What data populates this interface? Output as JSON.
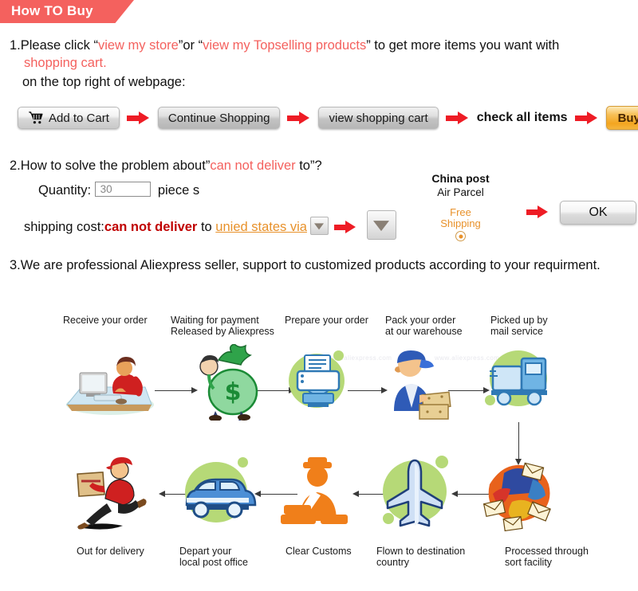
{
  "banner": {
    "title": "How TO Buy",
    "color": "#f4615e"
  },
  "colors": {
    "accent_red": "#f4615e",
    "arrow_red": "#ee1c25",
    "dark_red": "#c00000",
    "orange": "#e8912a",
    "buy_now_bg": "#f3a520",
    "blob_green": "#b6d977"
  },
  "section1": {
    "number": "1.",
    "line1_a": "Please click “",
    "link1": "view my store",
    "line1_b": "”or “",
    "link2": "view my Topselling products",
    "line1_c": "” to get more items you want with",
    "line2": "shopping cart.",
    "line3": "on the top right of webpage:",
    "buttons": {
      "add_to_cart": "Add to Cart",
      "continue_shopping": "Continue Shopping",
      "view_shopping_cart": "view shopping cart",
      "check_all_items": "check all items",
      "buy_now": "Buy now"
    }
  },
  "section2": {
    "number": "2.",
    "line1_a": "How to solve the problem about”",
    "line1_red": "can not deliver",
    "line1_b": " to”?",
    "quantity_label": "Quantity:",
    "quantity_value": "30",
    "quantity_unit": "piece s",
    "shipping_label": "shipping cost:",
    "shipping_red": "can not deliver",
    "shipping_to": " to ",
    "shipping_link": "unied states via",
    "carrier": "China post",
    "service": "Air Parcel",
    "free_line1": "Free",
    "free_line2": "Shipping",
    "ok_button": "OK"
  },
  "section3": {
    "number": "3.",
    "text": "We are professional Aliexpress seller, support to customized products according to your requirment."
  },
  "flow": {
    "steps_top": [
      {
        "label": "Receive your order",
        "icon": "person-at-computer-icon"
      },
      {
        "label": "Waiting for payment\nReleased by Aliexpress",
        "icon": "money-bag-icon"
      },
      {
        "label": "Prepare your order",
        "icon": "printer-icon"
      },
      {
        "label": "Pack your order\nat our warehouse",
        "icon": "warehouse-worker-icon"
      },
      {
        "label": "Picked up by\nmail service",
        "icon": "delivery-truck-icon"
      }
    ],
    "steps_bottom": [
      {
        "label": "Out for delivery",
        "icon": "running-courier-icon"
      },
      {
        "label": "Depart your\nlocal post office",
        "icon": "delivery-van-icon"
      },
      {
        "label": "Clear Customs",
        "icon": "customs-officer-icon"
      },
      {
        "label": "Flown to destination\ncountry",
        "icon": "airplane-icon"
      },
      {
        "label": "Processed through\nsort facility",
        "icon": "mail-sorting-icon"
      }
    ]
  }
}
